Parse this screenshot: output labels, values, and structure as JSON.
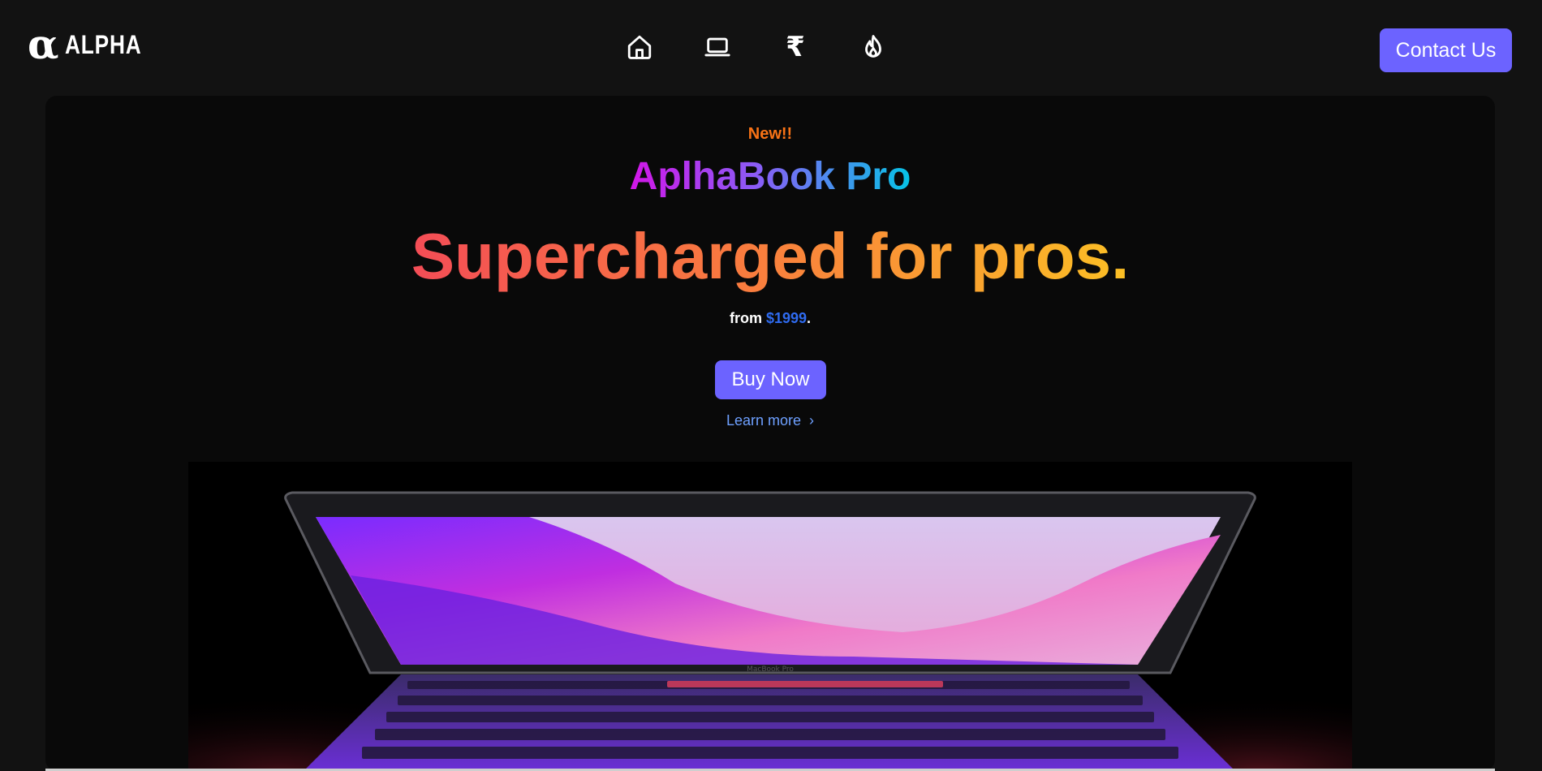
{
  "brand": {
    "logo_mark": "α",
    "logo_text": "ALPHA"
  },
  "nav": {
    "icons": [
      "home-icon",
      "laptop-icon",
      "rupee-icon",
      "fire-icon"
    ],
    "rupee_glyph": "₹"
  },
  "contact_label": "Contact Us",
  "hero": {
    "badge": "New!!",
    "product_name": "AplhaBook Pro",
    "headline": "Supercharged for pros.",
    "price_prefix": "from ",
    "price": "$1999",
    "price_suffix": ".",
    "buy_label": "Buy Now",
    "learn_more": "Learn more",
    "learn_more_chevron": "›",
    "laptop_screen_label": "MacBook Pro"
  },
  "colors": {
    "accent": "#6c63ff",
    "badge": "#f97316",
    "price": "#2f6bf0",
    "link": "#6ea0ff"
  }
}
